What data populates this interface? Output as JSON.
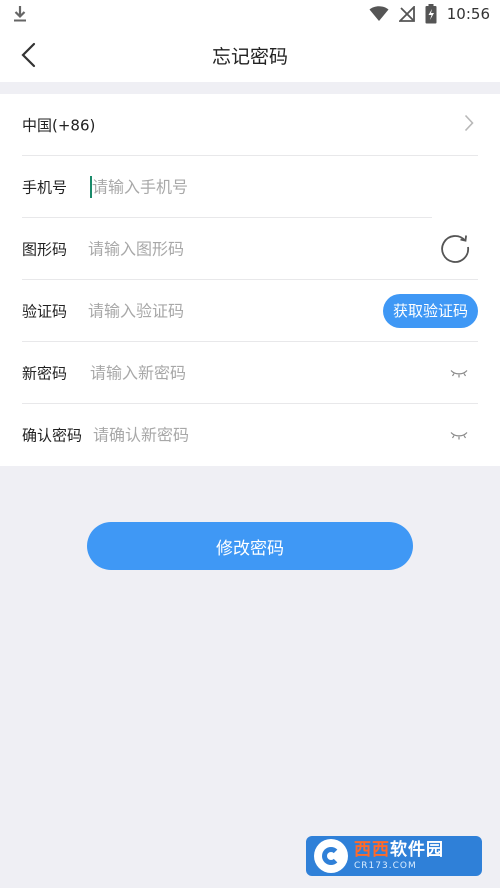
{
  "status_bar": {
    "time": "10:56",
    "icons": [
      "download-icon",
      "wifi-icon",
      "no-signal-icon",
      "battery-charging-icon"
    ]
  },
  "header": {
    "title": "忘记密码",
    "back_icon": "chevron-left-icon"
  },
  "form": {
    "country": {
      "label": "中国(+86)",
      "icon": "chevron-right-icon"
    },
    "phone": {
      "label": "手机号",
      "placeholder": "请输入手机号"
    },
    "captcha": {
      "label": "图形码",
      "placeholder": "请输入图形码",
      "icon": "refresh-icon"
    },
    "sms": {
      "label": "验证码",
      "placeholder": "请输入验证码",
      "button_label": "获取验证码"
    },
    "new_password": {
      "label": "新密码",
      "placeholder": "请输入新密码",
      "icon": "eye-closed-icon"
    },
    "confirm_password": {
      "label": "确认密码",
      "placeholder": "请确认新密码",
      "icon": "eye-closed-icon"
    }
  },
  "submit_label": "修改密码",
  "watermark": {
    "main_prefix": "",
    "main_highlight": "西西",
    "main_suffix": "软件园",
    "sub": "CR173.COM"
  },
  "colors": {
    "accent": "#3f98f5",
    "background": "#efeff4",
    "placeholder": "#a8a8a8"
  }
}
